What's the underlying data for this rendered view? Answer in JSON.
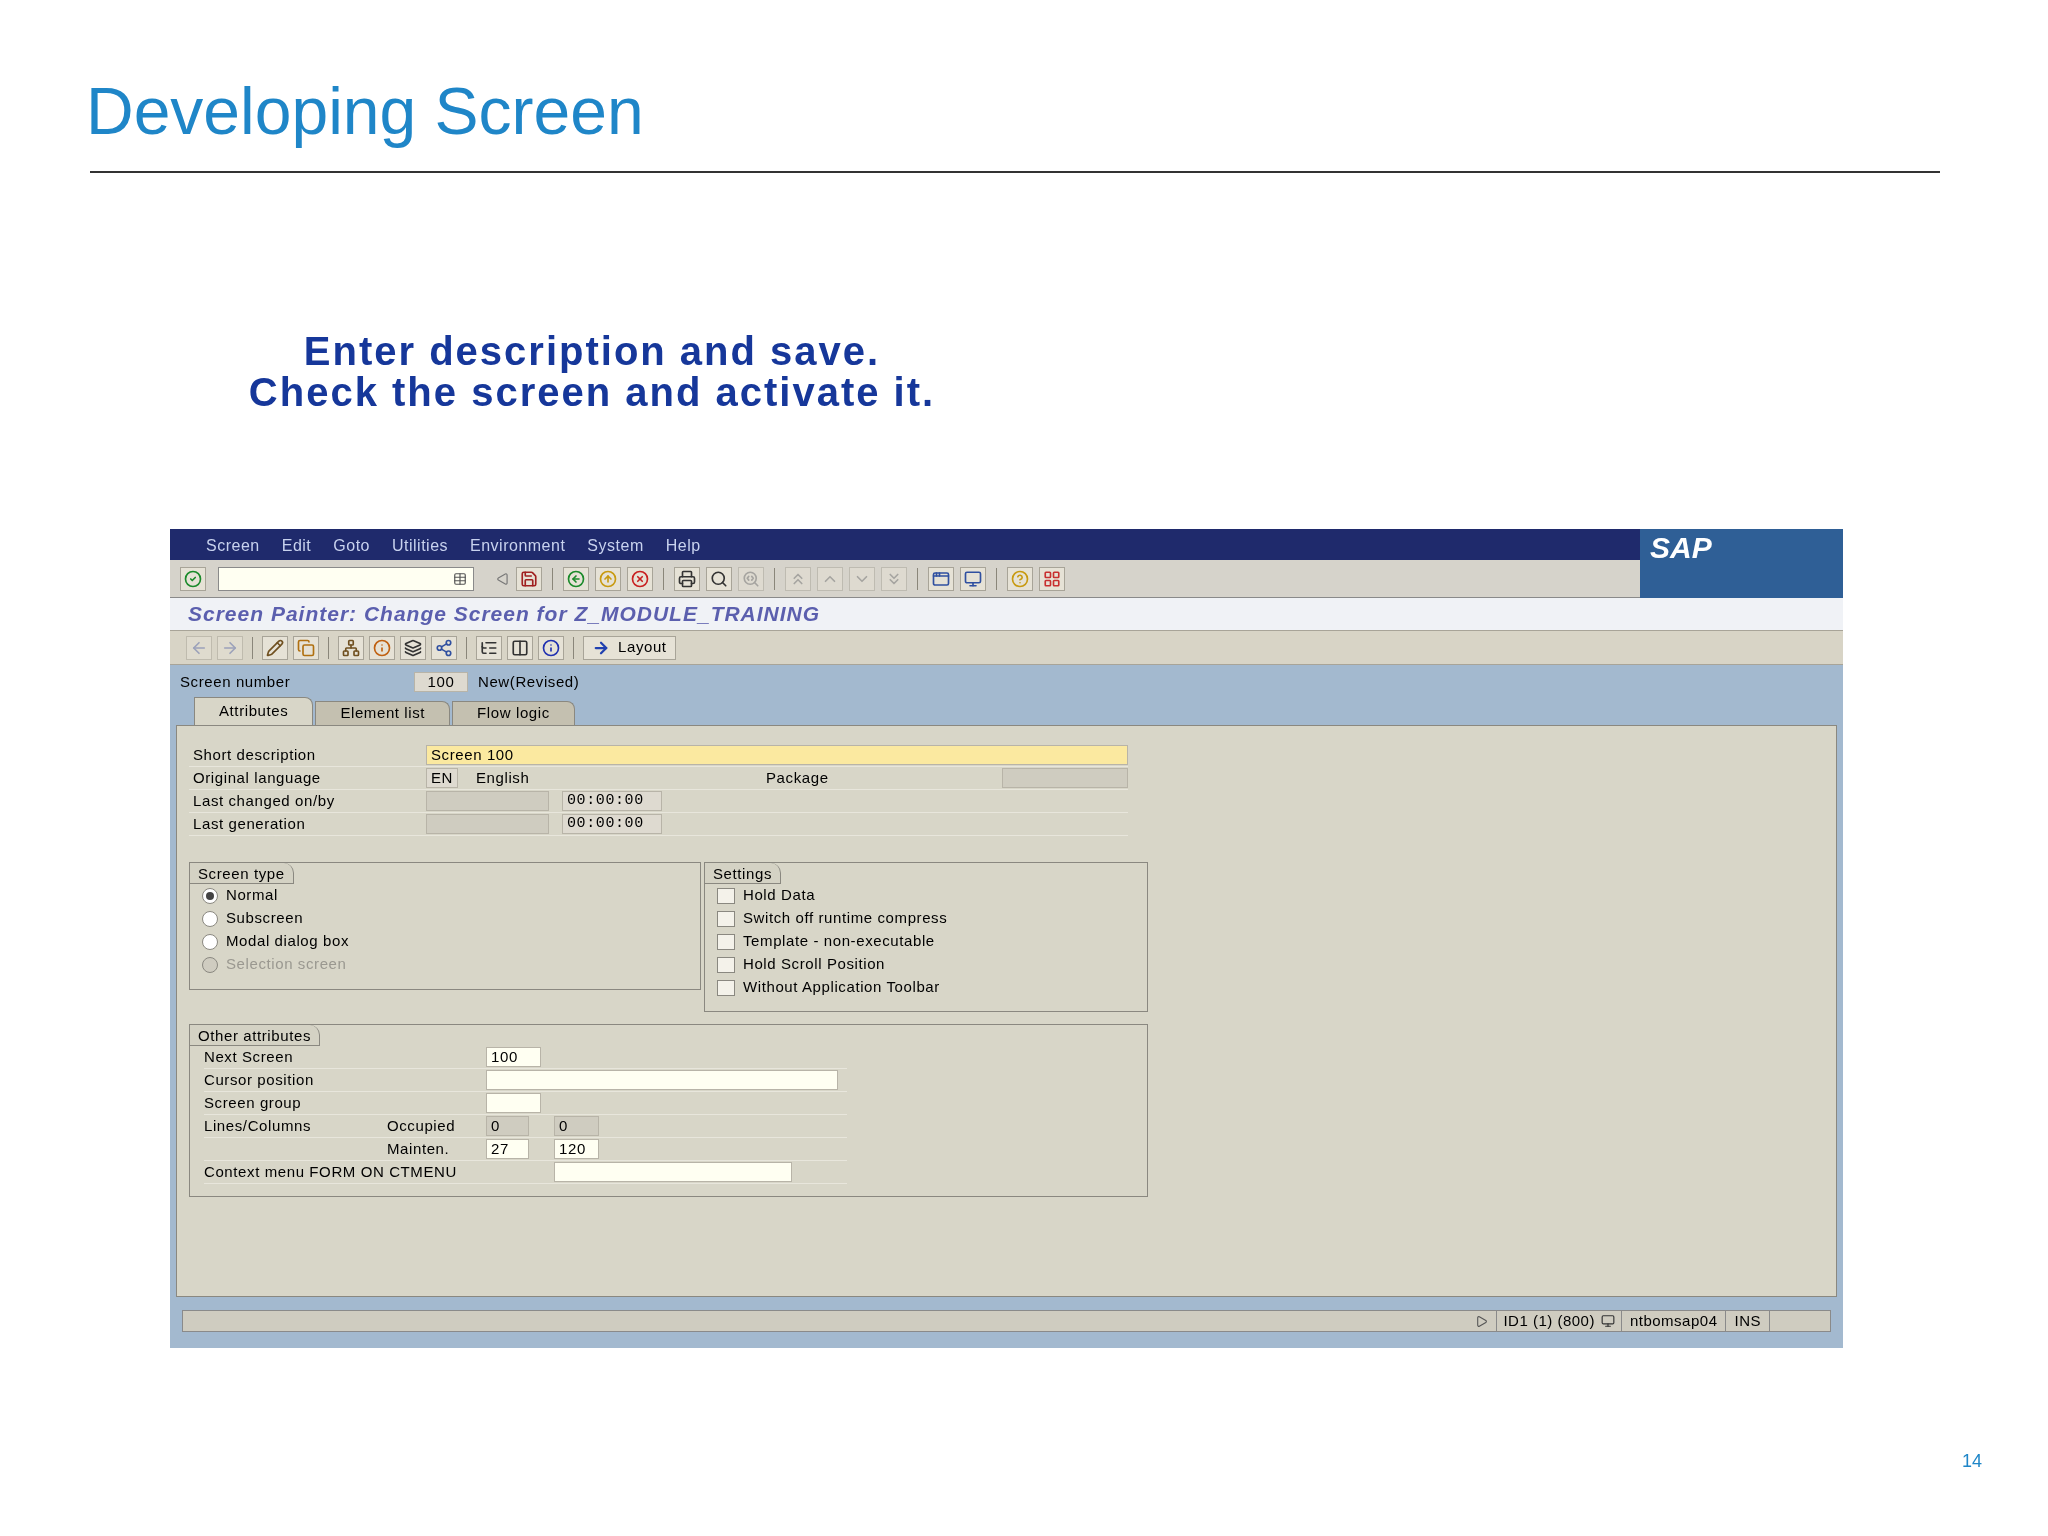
{
  "slide": {
    "title": "Developing Screen",
    "instructions": [
      "Enter description and save.",
      "Check the screen and activate it."
    ],
    "page_number": "14"
  },
  "window": {
    "menu": [
      "Screen",
      "Edit",
      "Goto",
      "Utilities",
      "Environment",
      "System",
      "Help"
    ],
    "logo": "SAP",
    "title": "Screen Painter: Change Screen for Z_MODULE_TRAINING",
    "layout_button": "Layout"
  },
  "screen_number": {
    "label": "Screen number",
    "value": "100",
    "status": "New(Revised)"
  },
  "tabs": [
    {
      "label": "Attributes",
      "selected": true
    },
    {
      "label": "Element list",
      "selected": false
    },
    {
      "label": "Flow logic",
      "selected": false
    }
  ],
  "attributes": {
    "short_description": {
      "label": "Short description",
      "value": "Screen 100"
    },
    "original_language": {
      "label": "Original language",
      "code": "EN",
      "name": "English"
    },
    "package": {
      "label": "Package"
    },
    "last_changed": {
      "label": "Last changed on/by",
      "time": "00:00:00"
    },
    "last_generation": {
      "label": "Last generation",
      "time": "00:00:00"
    }
  },
  "screen_type": {
    "title": "Screen type",
    "options": [
      {
        "label": "Normal",
        "selected": true,
        "disabled": false
      },
      {
        "label": "Subscreen",
        "selected": false,
        "disabled": false
      },
      {
        "label": "Modal dialog box",
        "selected": false,
        "disabled": false
      },
      {
        "label": "Selection screen",
        "selected": false,
        "disabled": true
      }
    ]
  },
  "settings": {
    "title": "Settings",
    "options": [
      {
        "label": "Hold Data",
        "checked": false
      },
      {
        "label": "Switch off runtime compress",
        "checked": false
      },
      {
        "label": "Template - non-executable",
        "checked": false
      },
      {
        "label": "Hold Scroll Position",
        "checked": false
      },
      {
        "label": "Without Application Toolbar",
        "checked": false
      }
    ]
  },
  "other_attributes": {
    "title": "Other attributes",
    "next_screen": {
      "label": "Next Screen",
      "value": "100"
    },
    "cursor_position": {
      "label": "Cursor position"
    },
    "screen_group": {
      "label": "Screen group"
    },
    "lines_columns": {
      "label": "Lines/Columns",
      "occupied": {
        "label": "Occupied",
        "lines": "0",
        "columns": "0"
      },
      "mainten": {
        "label": "Mainten.",
        "lines": "27",
        "columns": "120"
      }
    },
    "context_menu": {
      "label": "Context menu FORM ON CTMENU"
    }
  },
  "status_bar": {
    "system": "ID1 (1) (800)",
    "server": "ntbomsap04",
    "mode": "INS"
  }
}
